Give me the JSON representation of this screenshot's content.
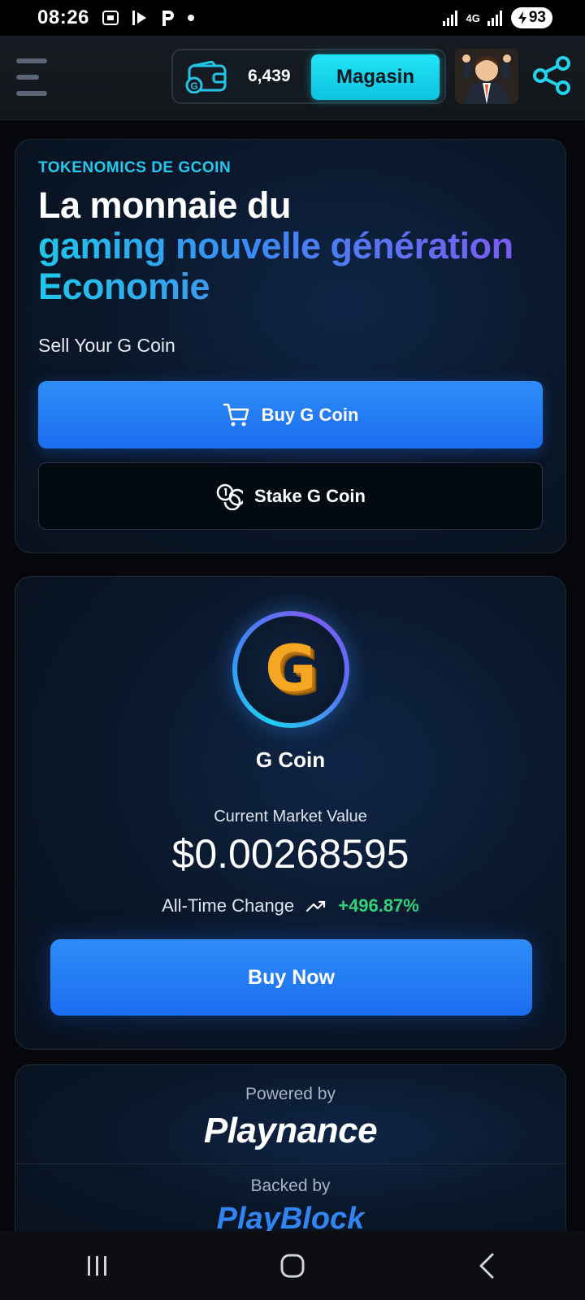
{
  "status_bar": {
    "time": "08:26",
    "network": "4G",
    "battery": "93"
  },
  "header": {
    "coin_balance": "6,439",
    "shop_label": "Magasin"
  },
  "hero": {
    "eyebrow": "TOKENOMICS DE GCOIN",
    "headline_line1": "La monnaie du",
    "headline_line2": "gaming nouvelle génération",
    "headline_line3": "Economie",
    "subtitle": "Sell Your G Coin",
    "buy_label": "Buy G Coin",
    "stake_label": "Stake G Coin"
  },
  "coin": {
    "symbol": "G",
    "name": "G Coin",
    "market_label": "Current Market Value",
    "market_value": "$0.00268595",
    "change_label": "All-Time Change",
    "change_value": "+496.87%",
    "buy_now_label": "Buy Now"
  },
  "partners": {
    "powered_label": "Powered by",
    "powered_name": "Playnance",
    "backed_label": "Backed by",
    "backed_name": "PlayBlock"
  },
  "colors": {
    "accent_cyan": "#22e4f7",
    "primary_blue": "#1a6ef0",
    "positive_green": "#33d17a",
    "coin_gold": "#f5a623"
  }
}
